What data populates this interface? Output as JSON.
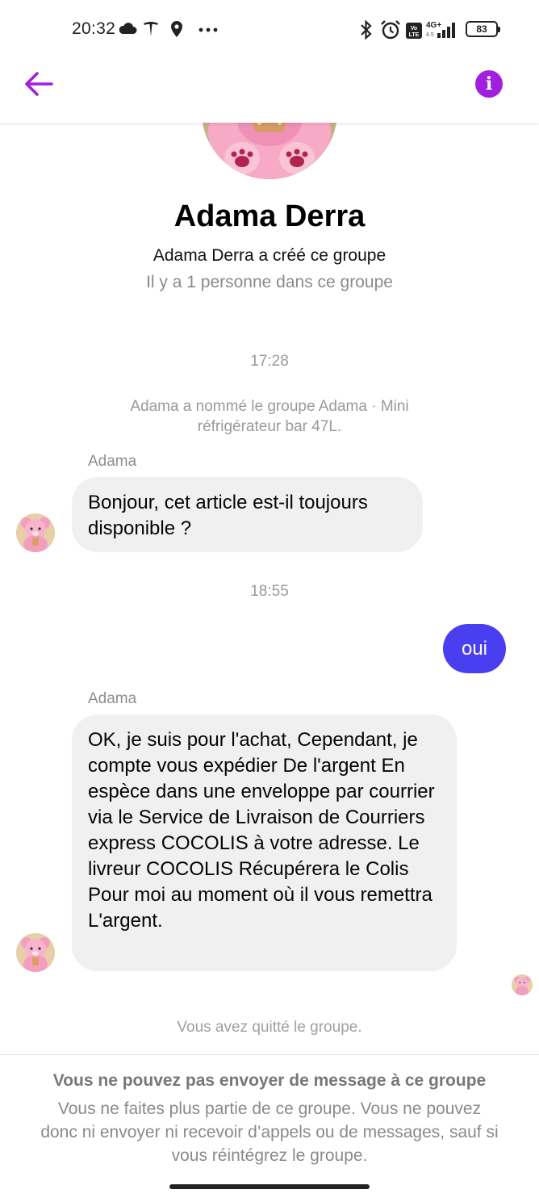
{
  "status_bar": {
    "time": "20:32",
    "battery": "83",
    "icons": [
      "cloud-icon",
      "tesla-icon",
      "location-icon",
      "more-icon",
      "bluetooth-icon",
      "alarm-icon",
      "volte-icon",
      "signal-4g-icon",
      "battery-icon"
    ]
  },
  "header": {
    "back_icon": "arrow-left-icon",
    "info_icon": "info-icon",
    "info_glyph": "i",
    "accent_color": "#a21fe0"
  },
  "group": {
    "name": "Adama Derra",
    "created_text": "Adama Derra a créé ce groupe",
    "member_count_text": "Il y a 1 personne dans ce groupe"
  },
  "conversation": {
    "time_1": "17:28",
    "system_rename": "Adama a nommé le groupe Adama · Mini réfrigérateur bar 47L.",
    "msg_1": {
      "sender": "Adama",
      "text": "Bonjour, cet article est-il toujours disponible ?"
    },
    "time_2": "18:55",
    "msg_out": {
      "text": "oui",
      "color": "#4a3ff0"
    },
    "msg_2": {
      "sender": "Adama",
      "text": "OK, je suis pour l'achat, Cependant, je compte vous expédier De l'argent En espèce dans une enveloppe par courrier via le Service de Livraison de Courriers express COCOLIS à votre adresse. Le livreur COCOLIS Récupérera le Colis Pour moi au moment où il vous remettra L'argent."
    },
    "left_notice": "Vous avez quitté le groupe."
  },
  "footer": {
    "title": "Vous ne pouvez pas envoyer de message à ce groupe",
    "body": "Vous ne faites plus partie de ce groupe. Vous ne pouvez donc ni envoyer ni recevoir d’appels ou de messages, sauf si vous réintégrez le groupe."
  }
}
